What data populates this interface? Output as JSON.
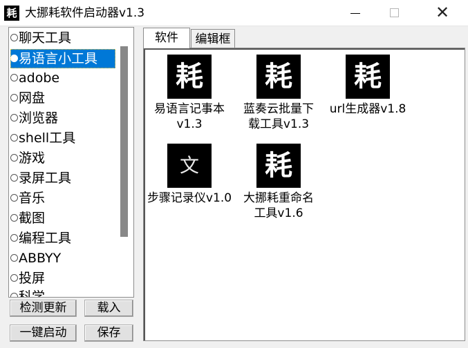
{
  "window": {
    "title": "大挪耗软件启动器v1.3",
    "icon_glyph": "耗",
    "close_glyph": "✕"
  },
  "categories": [
    {
      "label": "聊天工具",
      "selected": false
    },
    {
      "label": "易语言小工具",
      "selected": true
    },
    {
      "label": "adobe",
      "selected": false
    },
    {
      "label": "网盘",
      "selected": false
    },
    {
      "label": "浏览器",
      "selected": false
    },
    {
      "label": "shell工具",
      "selected": false
    },
    {
      "label": "游戏",
      "selected": false
    },
    {
      "label": "录屏工具",
      "selected": false
    },
    {
      "label": "音乐",
      "selected": false
    },
    {
      "label": "截图",
      "selected": false
    },
    {
      "label": "编程工具",
      "selected": false
    },
    {
      "label": "ABBYY",
      "selected": false
    },
    {
      "label": "投屏",
      "selected": false
    },
    {
      "label": "科学",
      "selected": false
    }
  ],
  "buttons": {
    "check_update": "检测更新",
    "load": "载入",
    "one_click_start": "一键启动",
    "save": "保存"
  },
  "tabs": [
    {
      "label": "软件",
      "active": true
    },
    {
      "label": "编辑框",
      "active": false
    }
  ],
  "apps": [
    {
      "icon_glyph": "耗",
      "line1": "易语言记事本",
      "line2": "v1.3"
    },
    {
      "icon_glyph": "耗",
      "line1": "蓝奏云批量下",
      "line2": "载工具v1.3"
    },
    {
      "icon_glyph": "耗",
      "line1": "url生成器v1.8",
      "line2": ""
    },
    {
      "icon_glyph": "文",
      "line1": "步骤记录仪v1.0",
      "line2": ""
    },
    {
      "icon_glyph": "耗",
      "line1": "大挪耗重命名",
      "line2": "工具v1.6"
    }
  ]
}
